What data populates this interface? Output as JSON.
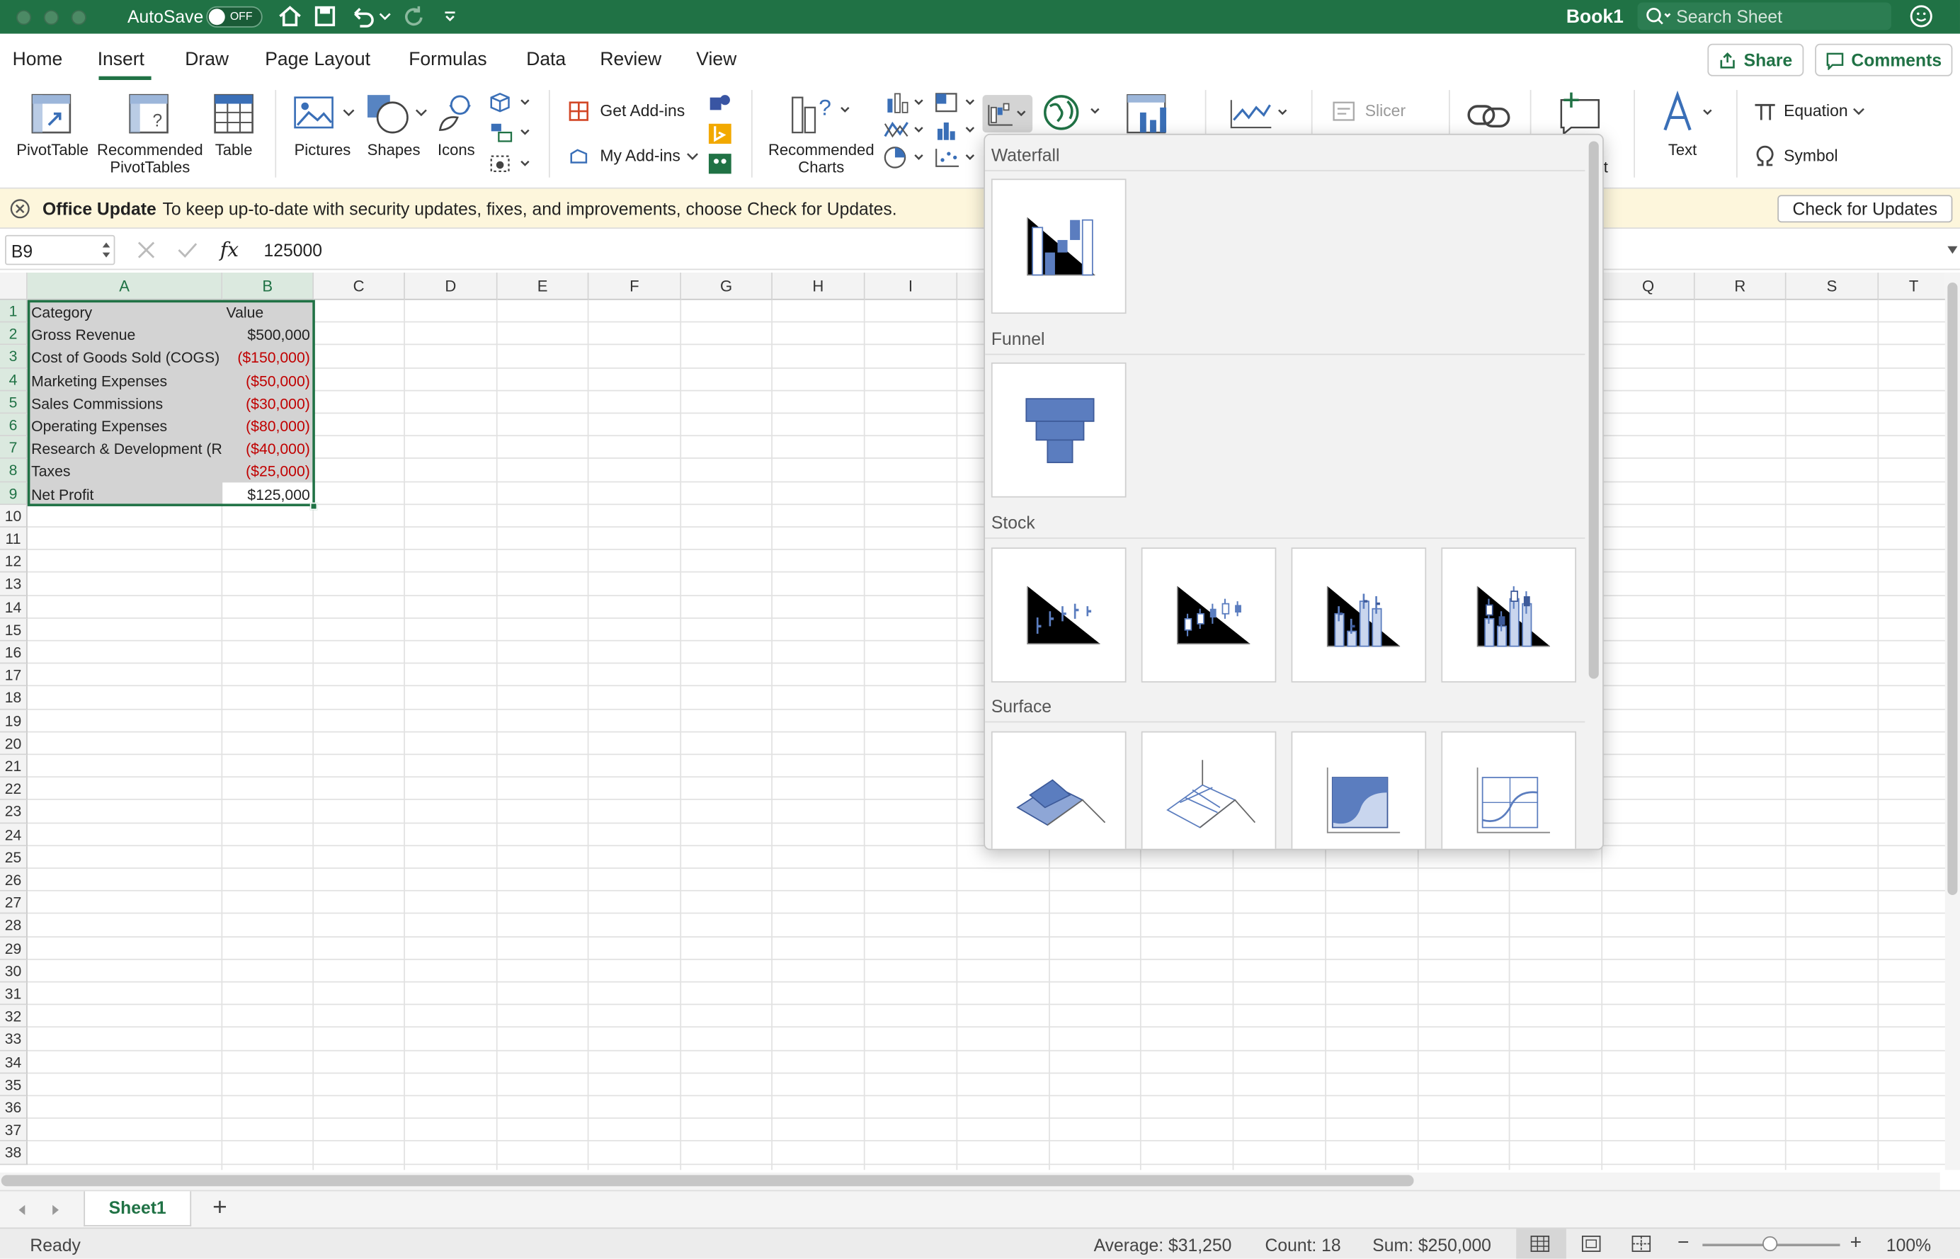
{
  "title_bar": {
    "autosave_label": "AutoSave",
    "autosave_state": "OFF",
    "workbook_title": "Book1",
    "search_placeholder": "Search Sheet"
  },
  "ribbon_tabs": [
    {
      "label": "Home"
    },
    {
      "label": "Insert"
    },
    {
      "label": "Draw"
    },
    {
      "label": "Page Layout"
    },
    {
      "label": "Formulas"
    },
    {
      "label": "Data"
    },
    {
      "label": "Review"
    },
    {
      "label": "View"
    }
  ],
  "active_tab": "Insert",
  "share_label": "Share",
  "comments_label": "Comments",
  "ribbon": {
    "pivottable": "PivotTable",
    "recommended_pivot_line1": "Recommended",
    "recommended_pivot_line2": "PivotTables",
    "table": "Table",
    "pictures": "Pictures",
    "shapes": "Shapes",
    "icons": "Icons",
    "get_addins": "Get Add-ins",
    "my_addins": "My Add-ins",
    "recommended_charts_line1": "Recommended",
    "recommended_charts_line2": "Charts",
    "slicer": "Slicer",
    "comment_partial": "nt",
    "text": "Text",
    "equation": "Equation",
    "symbol": "Symbol"
  },
  "notice": {
    "title": "Office Update",
    "message": "To keep up-to-date with security updates, fixes, and improvements, choose Check for Updates.",
    "button": "Check for Updates"
  },
  "formula_bar": {
    "name_box": "B9",
    "fx": "fx",
    "value": "125000"
  },
  "columns": [
    "A",
    "B",
    "C",
    "D",
    "E",
    "F",
    "G",
    "H",
    "I",
    "Q",
    "R",
    "S",
    "T"
  ],
  "rows": [
    "1",
    "2",
    "3",
    "4",
    "5",
    "6",
    "7",
    "8",
    "9",
    "10",
    "11",
    "12",
    "13",
    "14",
    "15",
    "16",
    "17",
    "18",
    "19",
    "20",
    "21",
    "22",
    "23",
    "24",
    "25",
    "26",
    "27",
    "28",
    "29",
    "30",
    "31",
    "32",
    "33",
    "34",
    "35",
    "36",
    "37",
    "38"
  ],
  "cells": [
    {
      "a": "Category",
      "b": "Value"
    },
    {
      "a": "Gross Revenue",
      "b": "$500,000"
    },
    {
      "a": "Cost of Goods Sold (COGS)",
      "b": "($150,000)"
    },
    {
      "a": "Marketing Expenses",
      "b": "($50,000)"
    },
    {
      "a": "Sales Commissions",
      "b": "($30,000)"
    },
    {
      "a": "Operating Expenses",
      "b": "($80,000)"
    },
    {
      "a": "Research & Development (Ra",
      "b": "($40,000)"
    },
    {
      "a": "Taxes",
      "b": "($25,000)"
    },
    {
      "a": "Net Profit",
      "b": "$125,000"
    }
  ],
  "chart_menu": {
    "sections": [
      {
        "name": "Waterfall"
      },
      {
        "name": "Funnel"
      },
      {
        "name": "Stock"
      },
      {
        "name": "Surface"
      }
    ]
  },
  "sheet_tabs": [
    {
      "label": "Sheet1"
    }
  ],
  "add_sheet": "+",
  "status": {
    "ready": "Ready",
    "average": "Average: $31,250",
    "count": "Count: 18",
    "sum": "Sum: $250,000",
    "zoom": "100%",
    "zoom_minus": "−",
    "zoom_plus": "+"
  },
  "colors": {
    "excel_green": "#207245",
    "chart_blue": "#5b7dbf",
    "negative_red": "#c00000"
  }
}
